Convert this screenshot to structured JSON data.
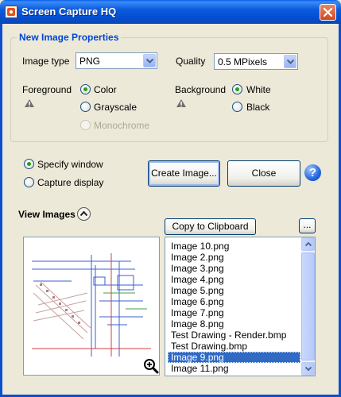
{
  "window": {
    "title": "Screen Capture HQ"
  },
  "properties": {
    "group_title": "New Image Properties",
    "image_type_label": "Image type",
    "image_type_value": "PNG",
    "quality_label": "Quality",
    "quality_value": "0.5 MPixels",
    "foreground_label": "Foreground",
    "foreground_options": [
      "Color",
      "Grayscale",
      "Monochrome"
    ],
    "foreground_selected": "Color",
    "background_label": "Background",
    "background_options": [
      "White",
      "Black"
    ],
    "background_selected": "White"
  },
  "capture": {
    "specify_window": "Specify window",
    "capture_display": "Capture display",
    "selected": "Specify window",
    "create_label": "Create Image...",
    "close_label": "Close",
    "help_glyph": "?"
  },
  "view": {
    "title": "View Images",
    "copy_label": "Copy to Clipboard",
    "more_label": "...",
    "images": [
      "Image 10.png",
      "Image 2.png",
      "Image 3.png",
      "Image 4.png",
      "Image 5.png",
      "Image 6.png",
      "Image 7.png",
      "Image 8.png",
      "Test Drawing - Render.bmp",
      "Test Drawing.bmp",
      "Image 9.png",
      "Image 11.png"
    ],
    "selected_image": "Image 9.png"
  },
  "icons": {
    "app": "screen-capture-app-icon",
    "close": "close-icon",
    "warning": "warning-icon",
    "help": "help-icon",
    "collapse": "chevron-up-icon",
    "zoom": "zoom-in-icon"
  },
  "colors": {
    "title_bar": "#0A5FE8",
    "group_title": "#0046D5",
    "selection": "#316AC5",
    "radio_dot": "#21A121"
  }
}
